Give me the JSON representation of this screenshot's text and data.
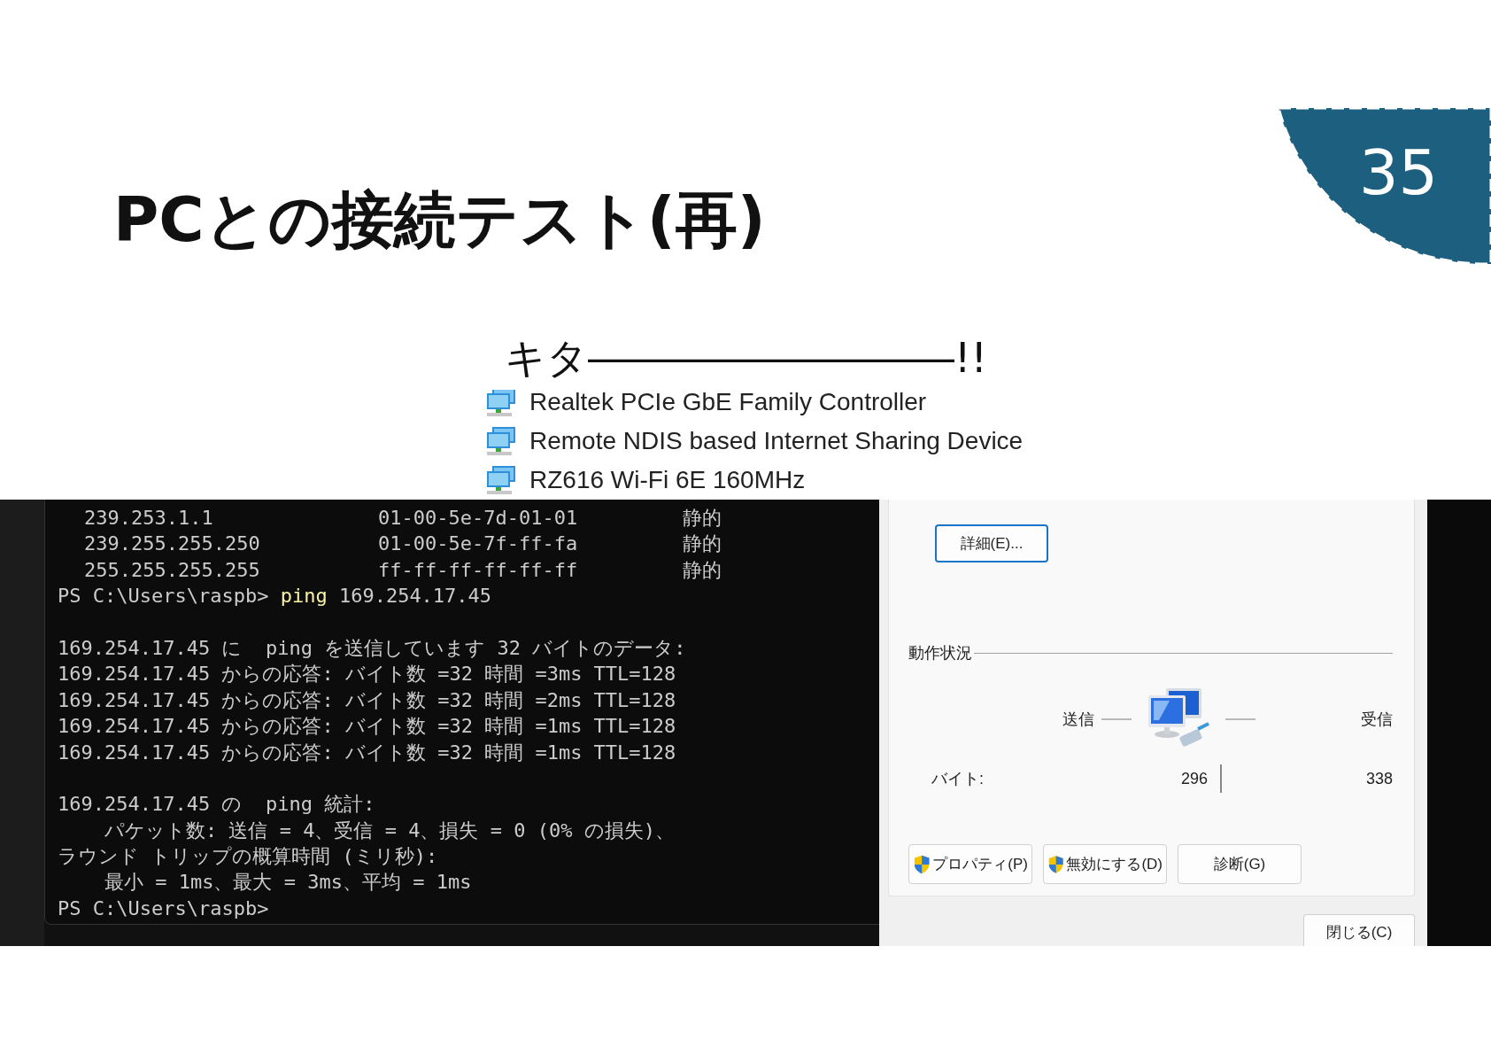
{
  "slide": {
    "title": "PCとの接続テスト(再)",
    "page_number": "35",
    "heading": "キタ―――――――――!!"
  },
  "adapter_list": [
    {
      "name": "Realtek PCIe GbE Family Controller"
    },
    {
      "name": "Remote NDIS based Internet Sharing Device"
    },
    {
      "name": "RZ616 Wi-Fi 6E 160MHz"
    }
  ],
  "terminal": {
    "lines": [
      {
        "kind": "arp",
        "address": "239.253.1.1",
        "mac": "01-00-5e-7d-01-01",
        "type": "静的"
      },
      {
        "kind": "arp",
        "address": "239.255.255.250",
        "mac": "01-00-5e-7f-ff-fa",
        "type": "静的"
      },
      {
        "kind": "arp",
        "address": "255.255.255.255",
        "mac": "ff-ff-ff-ff-ff-ff",
        "type": "静的"
      },
      {
        "kind": "command",
        "prompt": "PS C:\\Users\\raspb>",
        "command": "ping",
        "args": "169.254.17.45"
      },
      {
        "kind": "blank"
      },
      {
        "kind": "output",
        "text": "169.254.17.45 に  ping を送信しています 32 バイトのデータ:"
      },
      {
        "kind": "output",
        "text": "169.254.17.45 からの応答: バイト数 =32 時間 =3ms TTL=128"
      },
      {
        "kind": "output",
        "text": "169.254.17.45 からの応答: バイト数 =32 時間 =2ms TTL=128"
      },
      {
        "kind": "output",
        "text": "169.254.17.45 からの応答: バイト数 =32 時間 =1ms TTL=128"
      },
      {
        "kind": "output",
        "text": "169.254.17.45 からの応答: バイト数 =32 時間 =1ms TTL=128"
      },
      {
        "kind": "blank"
      },
      {
        "kind": "output",
        "text": "169.254.17.45 の  ping 統計:"
      },
      {
        "kind": "output",
        "text": "    パケット数: 送信 = 4、受信 = 4、損失 = 0 (0% の損失)、"
      },
      {
        "kind": "output",
        "text": "ラウンド トリップの概算時間 (ミリ秒):"
      },
      {
        "kind": "output",
        "text": "    最小 = 1ms、最大 = 3ms、平均 = 1ms"
      },
      {
        "kind": "output",
        "text": "PS C:\\Users\\raspb>"
      }
    ]
  },
  "status_dialog": {
    "details_button": "詳細(E)...",
    "activity_label": "動作状況",
    "sent_label": "送信",
    "received_label": "受信",
    "bytes_label": "バイト:",
    "bytes_sent": "296",
    "bytes_received": "338",
    "buttons": [
      {
        "label": "プロパティ(P)",
        "shield": true
      },
      {
        "label": "無効にする(D)",
        "shield": true
      },
      {
        "label": "診断(G)",
        "shield": false
      }
    ],
    "close_button": "閉じる(C)"
  }
}
